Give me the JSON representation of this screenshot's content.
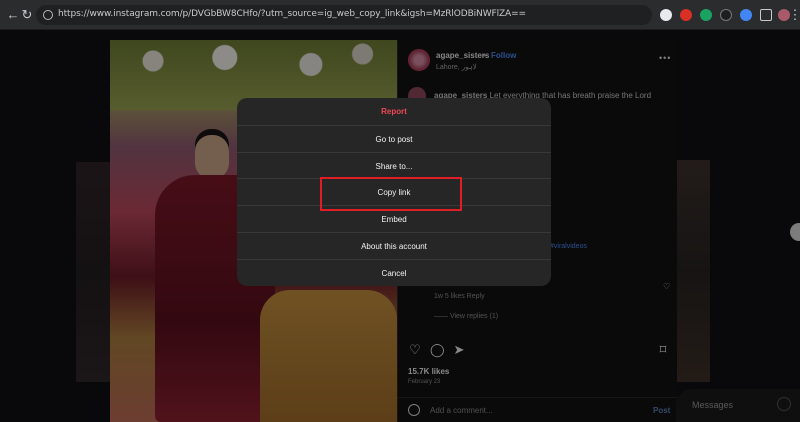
{
  "browser": {
    "url": "https://www.instagram.com/p/DVGbBW8CHfo/?utm_source=ig_web_copy_link&igsh=MzRlODBiNWFlZA==",
    "extension_colors": [
      "#e8eaed",
      "#d93025",
      "#1aa260",
      "#1e1e1e",
      "#4285f4",
      "#c7c9cc"
    ]
  },
  "post": {
    "username": "agape_sisters",
    "follow_label": "Follow",
    "location": "Lahore, لاہور",
    "caption_user": "agape_sisters",
    "caption_text": "Let everything that has breath praise the Lord",
    "hashtag": "#viralvideos",
    "comment_meta": "1w   5 likes   Reply",
    "view_replies": "—— View replies (1)",
    "likes": "15.7K likes",
    "date": "February 23",
    "add_comment_placeholder": "Add a comment...",
    "post_label": "Post"
  },
  "messages_label": "Messages",
  "menu": {
    "items": [
      {
        "label": "Report",
        "danger": true
      },
      {
        "label": "Go to post"
      },
      {
        "label": "Share to..."
      },
      {
        "label": "Copy link",
        "highlighted": true
      },
      {
        "label": "Embed"
      },
      {
        "label": "About this account"
      },
      {
        "label": "Cancel"
      }
    ]
  },
  "colors": {
    "accent_link": "#4a8af5",
    "danger": "#ed4956",
    "highlight_box": "#e01d24",
    "modal_bg": "#262626"
  }
}
